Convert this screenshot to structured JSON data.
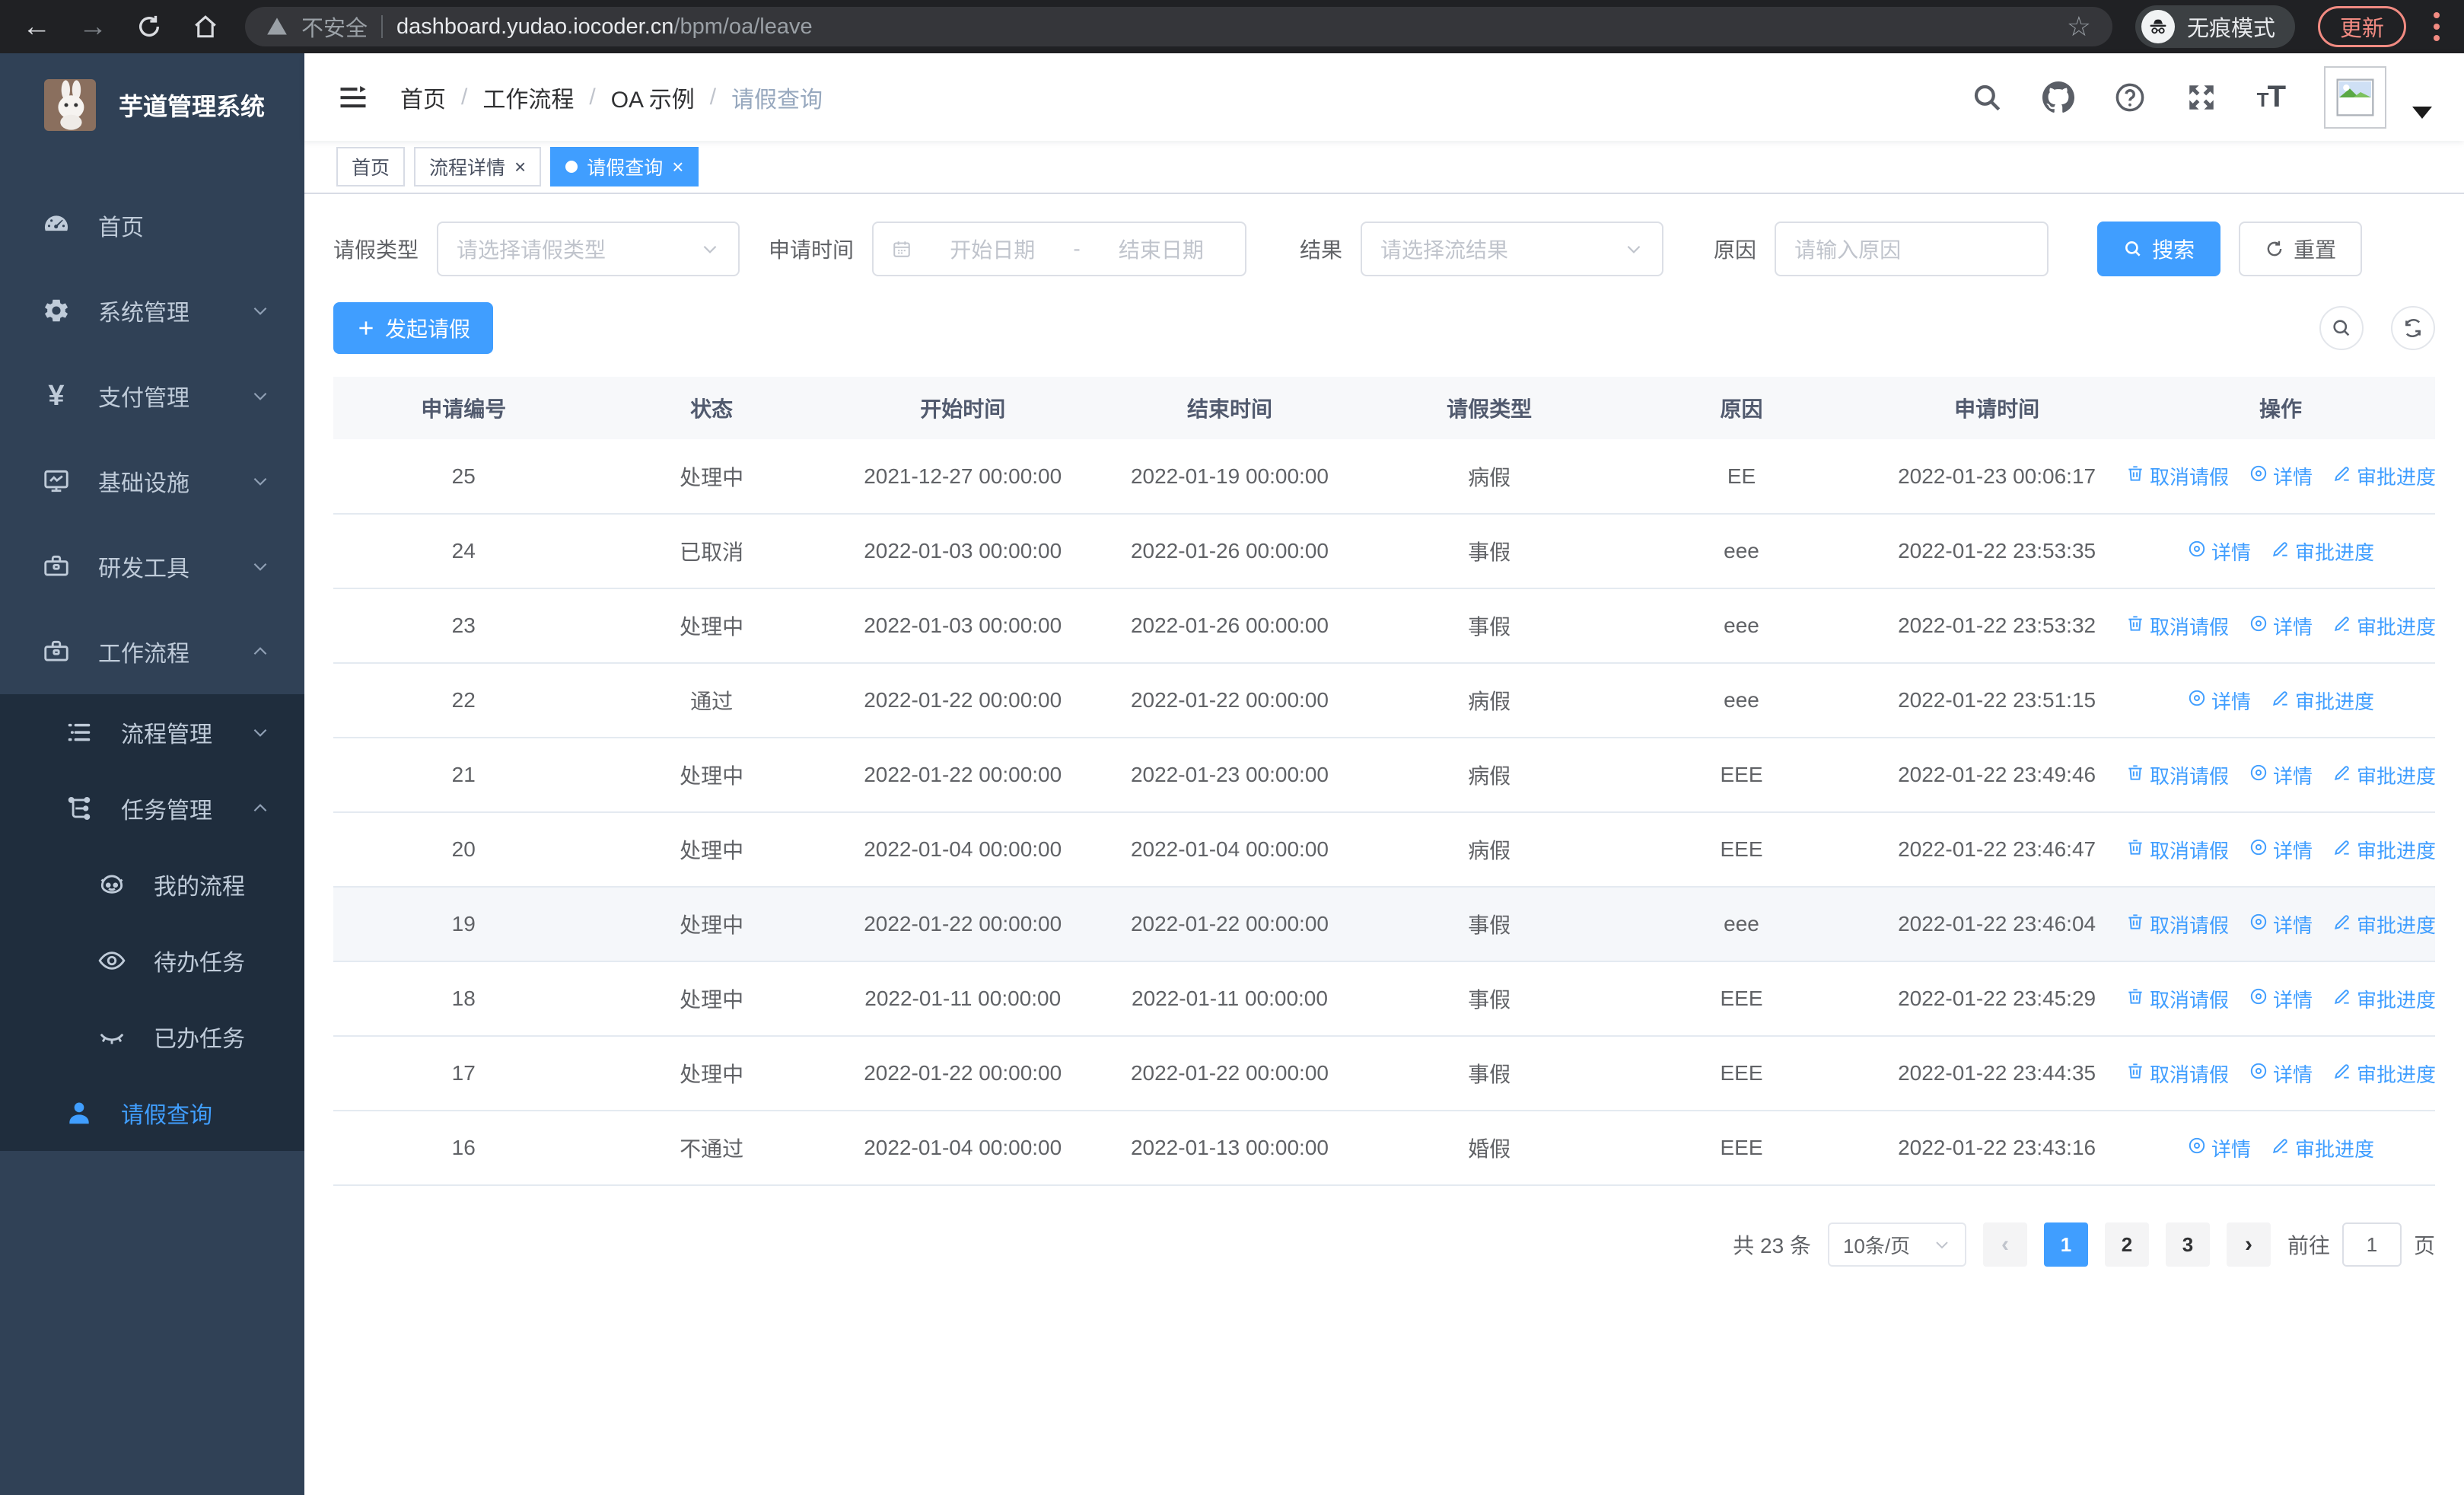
{
  "browser": {
    "security_label": "不安全",
    "url_host": "dashboard.yudao.iocoder.cn",
    "url_path": "/bpm/oa/leave",
    "incognito_label": "无痕模式",
    "update_label": "更新"
  },
  "sidebar": {
    "logo_title": "芋道管理系统",
    "menu": [
      {
        "key": "home",
        "icon": "dashboard-icon",
        "label": "首页",
        "depth": 0
      },
      {
        "key": "system",
        "icon": "gear-icon",
        "label": "系统管理",
        "depth": 0,
        "chevron": "down"
      },
      {
        "key": "payment",
        "icon": "yen-icon",
        "label": "支付管理",
        "depth": 0,
        "chevron": "down"
      },
      {
        "key": "infra",
        "icon": "infra-icon",
        "label": "基础设施",
        "depth": 0,
        "chevron": "down"
      },
      {
        "key": "devtools",
        "icon": "toolbox-icon",
        "label": "研发工具",
        "depth": 0,
        "chevron": "down"
      },
      {
        "key": "workflow",
        "icon": "toolbox-icon",
        "label": "工作流程",
        "depth": 0,
        "chevron": "up"
      },
      {
        "key": "process-mgmt",
        "icon": "process-icon",
        "label": "流程管理",
        "depth": 1,
        "submenu": true,
        "chevron": "down"
      },
      {
        "key": "task-mgmt",
        "icon": "task-icon",
        "label": "任务管理",
        "depth": 1,
        "submenu": true,
        "chevron": "up"
      },
      {
        "key": "my-process",
        "icon": "robot-icon",
        "label": "我的流程",
        "depth": 2,
        "submenu": true
      },
      {
        "key": "todo-task",
        "icon": "eye-icon",
        "label": "待办任务",
        "depth": 2,
        "submenu": true
      },
      {
        "key": "done-task",
        "icon": "eye-closed-icon",
        "label": "已办任务",
        "depth": 2,
        "submenu": true
      },
      {
        "key": "leave-query",
        "icon": "user-icon",
        "label": "请假查询",
        "depth": 1,
        "submenu": true,
        "active": true
      }
    ]
  },
  "breadcrumb": {
    "items": [
      "首页",
      "工作流程",
      "OA 示例",
      "请假查询"
    ]
  },
  "tabs": [
    {
      "label": "首页",
      "closable": false,
      "active": false
    },
    {
      "label": "流程详情",
      "closable": true,
      "active": false
    },
    {
      "label": "请假查询",
      "closable": true,
      "active": true
    }
  ],
  "filters": {
    "leave_type_label": "请假类型",
    "leave_type_placeholder": "请选择请假类型",
    "apply_time_label": "申请时间",
    "start_placeholder": "开始日期",
    "range_separator": "-",
    "end_placeholder": "结束日期",
    "result_label": "结果",
    "result_placeholder": "请选择流结果",
    "reason_label": "原因",
    "reason_placeholder": "请输入原因",
    "search_label": "搜索",
    "reset_label": "重置"
  },
  "toolbar": {
    "create_label": "发起请假"
  },
  "table": {
    "columns": [
      "申请编号",
      "状态",
      "开始时间",
      "结束时间",
      "请假类型",
      "原因",
      "申请时间",
      "操作"
    ],
    "action_labels": {
      "cancel": "取消请假",
      "detail": "详情",
      "progress": "审批进度"
    },
    "rows": [
      {
        "id": "25",
        "status": "处理中",
        "start": "2021-12-27 00:00:00",
        "end": "2022-01-19 00:00:00",
        "type": "病假",
        "reason": "EE",
        "apply_time": "2022-01-23 00:06:17",
        "actions": [
          "cancel",
          "detail",
          "progress"
        ],
        "hover": false
      },
      {
        "id": "24",
        "status": "已取消",
        "start": "2022-01-03 00:00:00",
        "end": "2022-01-26 00:00:00",
        "type": "事假",
        "reason": "eee",
        "apply_time": "2022-01-22 23:53:35",
        "actions": [
          "detail",
          "progress"
        ],
        "hover": false
      },
      {
        "id": "23",
        "status": "处理中",
        "start": "2022-01-03 00:00:00",
        "end": "2022-01-26 00:00:00",
        "type": "事假",
        "reason": "eee",
        "apply_time": "2022-01-22 23:53:32",
        "actions": [
          "cancel",
          "detail",
          "progress"
        ],
        "hover": false
      },
      {
        "id": "22",
        "status": "通过",
        "start": "2022-01-22 00:00:00",
        "end": "2022-01-22 00:00:00",
        "type": "病假",
        "reason": "eee",
        "apply_time": "2022-01-22 23:51:15",
        "actions": [
          "detail",
          "progress"
        ],
        "hover": false
      },
      {
        "id": "21",
        "status": "处理中",
        "start": "2022-01-22 00:00:00",
        "end": "2022-01-23 00:00:00",
        "type": "病假",
        "reason": "EEE",
        "apply_time": "2022-01-22 23:49:46",
        "actions": [
          "cancel",
          "detail",
          "progress"
        ],
        "hover": false
      },
      {
        "id": "20",
        "status": "处理中",
        "start": "2022-01-04 00:00:00",
        "end": "2022-01-04 00:00:00",
        "type": "病假",
        "reason": "EEE",
        "apply_time": "2022-01-22 23:46:47",
        "actions": [
          "cancel",
          "detail",
          "progress"
        ],
        "hover": false
      },
      {
        "id": "19",
        "status": "处理中",
        "start": "2022-01-22 00:00:00",
        "end": "2022-01-22 00:00:00",
        "type": "事假",
        "reason": "eee",
        "apply_time": "2022-01-22 23:46:04",
        "actions": [
          "cancel",
          "detail",
          "progress"
        ],
        "hover": true
      },
      {
        "id": "18",
        "status": "处理中",
        "start": "2022-01-11 00:00:00",
        "end": "2022-01-11 00:00:00",
        "type": "事假",
        "reason": "EEE",
        "apply_time": "2022-01-22 23:45:29",
        "actions": [
          "cancel",
          "detail",
          "progress"
        ],
        "hover": false
      },
      {
        "id": "17",
        "status": "处理中",
        "start": "2022-01-22 00:00:00",
        "end": "2022-01-22 00:00:00",
        "type": "事假",
        "reason": "EEE",
        "apply_time": "2022-01-22 23:44:35",
        "actions": [
          "cancel",
          "detail",
          "progress"
        ],
        "hover": false
      },
      {
        "id": "16",
        "status": "不通过",
        "start": "2022-01-04 00:00:00",
        "end": "2022-01-13 00:00:00",
        "type": "婚假",
        "reason": "EEE",
        "apply_time": "2022-01-22 23:43:16",
        "actions": [
          "detail",
          "progress"
        ],
        "hover": false
      }
    ]
  },
  "pagination": {
    "total_text": "共 23 条",
    "page_size": "10条/页",
    "pages": [
      "1",
      "2",
      "3"
    ],
    "active_page": "1",
    "goto_label": "前往",
    "goto_value": "1",
    "goto_suffix": "页"
  },
  "colors": {
    "primary": "#409eff",
    "sidebar_bg": "#304156",
    "submenu_bg": "#1f2d3d",
    "update_accent": "#f28b82"
  }
}
